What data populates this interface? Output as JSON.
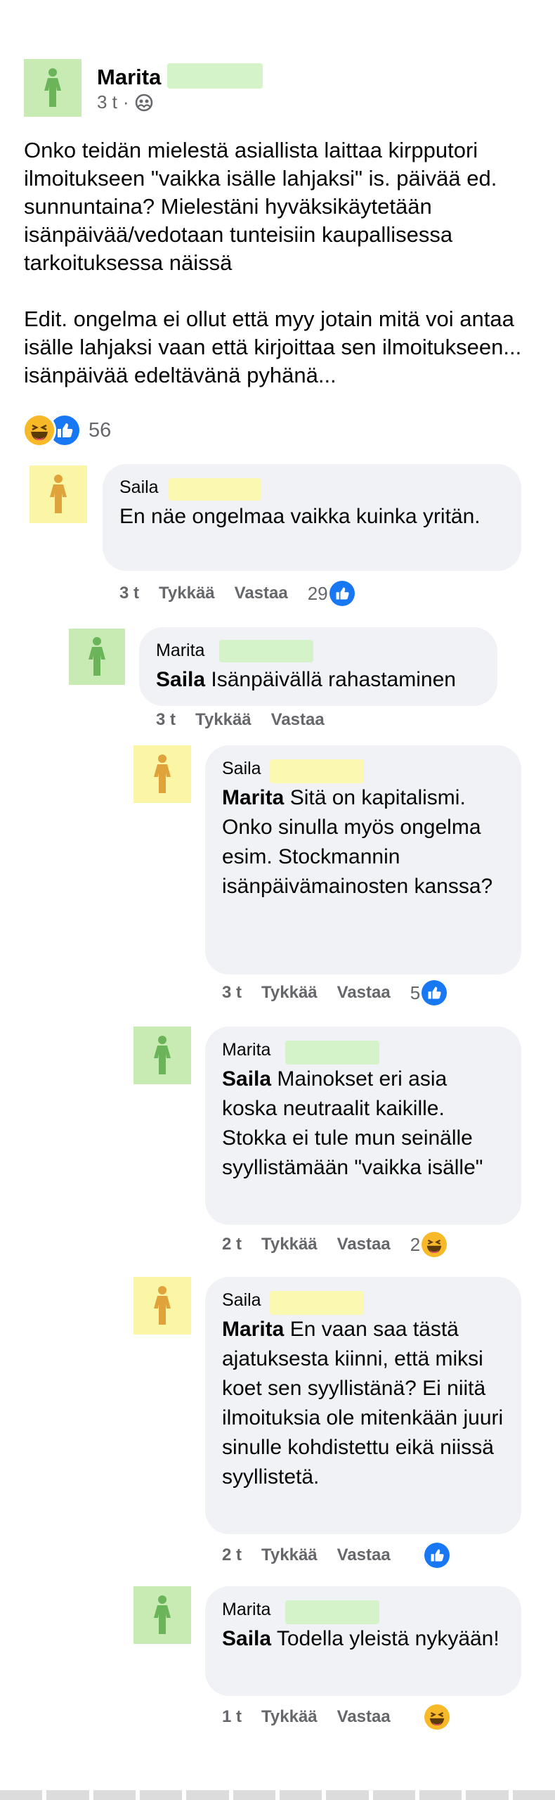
{
  "post": {
    "author": "Marita",
    "time": "3 t",
    "separator": "·",
    "audience_icon": "friends-icon",
    "body_paragraph_1": "Onko teidän mielestä asiallista laittaa kirpputori ilmoitukseen \"vaikka isälle lahjaksi\" is. päivää ed. sunnuntaina? Mielestäni hyväksikäytetään isänpäivää/vedotaan tunteisiin kaupallisessa tarkoituksessa näissä",
    "body_paragraph_2": "Edit. ongelma ei ollut että myy jotain mitä voi antaa isälle lahjaksi vaan että kirjoittaa sen ilmoitukseen... isänpäivää edeltävänä pyhänä...",
    "reaction_count": "56",
    "reactions": [
      "haha-icon",
      "like-icon"
    ]
  },
  "actions": {
    "like": "Tykkää",
    "reply": "Vastaa"
  },
  "comments": [
    {
      "author": "Saila",
      "text": "En näe ongelmaa vaikka kuinka yritän.",
      "mention": "",
      "time": "3 t",
      "likes": "29",
      "reaction": "like-icon"
    },
    {
      "author": "Marita",
      "mention": "Saila",
      "text": " Isänpäivällä rahastaminen",
      "time": "3 t",
      "likes": "",
      "reaction": ""
    },
    {
      "author": "Saila",
      "mention": "Marita",
      "text": " Sitä on kapitalismi. Onko sinulla myös ongelma esim. Stockmannin isänpäivämainosten kanssa?",
      "time": "3 t",
      "likes": "5",
      "reaction": "like-icon"
    },
    {
      "author": "Marita",
      "mention": "Saila",
      "text": " Mainokset eri asia koska neutraalit kaikille. Stokka ei tule mun seinälle syyllistämään \"vaikka isälle\"",
      "time": "2 t",
      "likes": "2",
      "reaction": "haha-icon"
    },
    {
      "author": "Saila",
      "mention": "Marita",
      "text": " En vaan saa tästä ajatuksesta kiinni, että miksi koet sen syyllistänä? Ei niitä ilmoituksia ole mitenkään juuri sinulle kohdistettu eikä niissä syyllistetä.",
      "time": "2 t",
      "likes": "",
      "reaction": "like-icon"
    },
    {
      "author": "Marita",
      "mention": "Saila",
      "text": " Todella yleistä nykyään!",
      "time": "1 t",
      "likes": "",
      "reaction": "haha-icon"
    }
  ],
  "colors": {
    "green_avatar": "#c8ebb4",
    "yellow_avatar": "#fbf6a6",
    "bubble": "#f0f2f5",
    "like_blue": "#1877f2",
    "meta_gray": "#65676b"
  }
}
